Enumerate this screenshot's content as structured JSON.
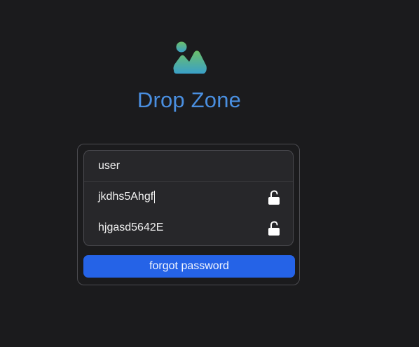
{
  "app": {
    "title": "Drop Zone",
    "logo_icon": "image-landscape-icon"
  },
  "login": {
    "username": "user",
    "password_1": "jkdhs5Ahgf",
    "password_2": "hjgasd5642E",
    "lock_icon": "unlocked-padlock-icon",
    "forgot_label": "forgot password"
  },
  "colors": {
    "background": "#1b1b1d",
    "title": "#4a8fe0",
    "accent_button": "#2563e7",
    "logo_gradient_top": "#5fb574",
    "logo_gradient_bottom": "#3aa3c9"
  }
}
